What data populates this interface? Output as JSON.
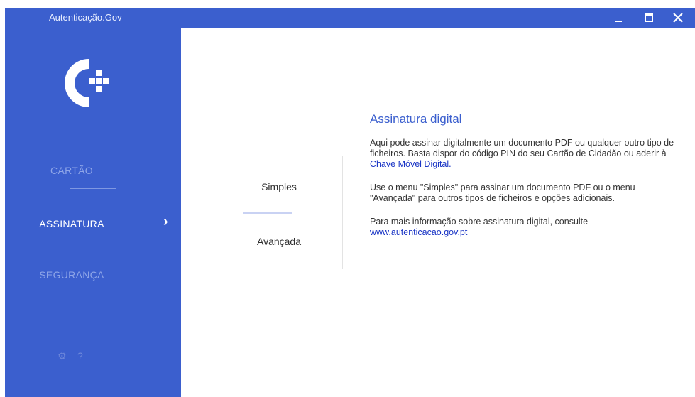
{
  "window": {
    "title": "Autenticação.Gov",
    "controls": {
      "minimize": "minimize-icon",
      "maximize": "maximize-icon",
      "close": "close-icon"
    }
  },
  "colors": {
    "sidebar": "#3b5fce",
    "accent": "#3b5fce",
    "link": "#1a35c5"
  },
  "sidebar": {
    "items": [
      {
        "label": "CARTÃO",
        "active": false
      },
      {
        "label": "ASSINATURA",
        "active": true
      },
      {
        "label": "SEGURANÇA",
        "active": false
      }
    ],
    "active_indicator": "›",
    "bottom_icons": [
      "settings-icon",
      "help-icon"
    ],
    "gear_glyph": "⚙",
    "help_glyph": "?"
  },
  "submenu": {
    "items": [
      "Simples",
      "Avançada"
    ]
  },
  "panel": {
    "title": "Assinatura digital",
    "p1_text": "Aqui pode assinar digitalmente um documento PDF ou qualquer outro tipo de ficheiros. Basta dispor do código PIN do seu Cartão de Cidadão ou aderir à ",
    "p1_link": "Chave Móvel Digital.",
    "p2_text": "Use o menu \"Simples\" para assinar um documento PDF ou o menu \"Avançada\" para outros tipos de ficheiros e opções adicionais.",
    "p3_text": "Para mais informação sobre assinatura digital, consulte",
    "p3_link": "www.autenticacao.gov.pt"
  }
}
